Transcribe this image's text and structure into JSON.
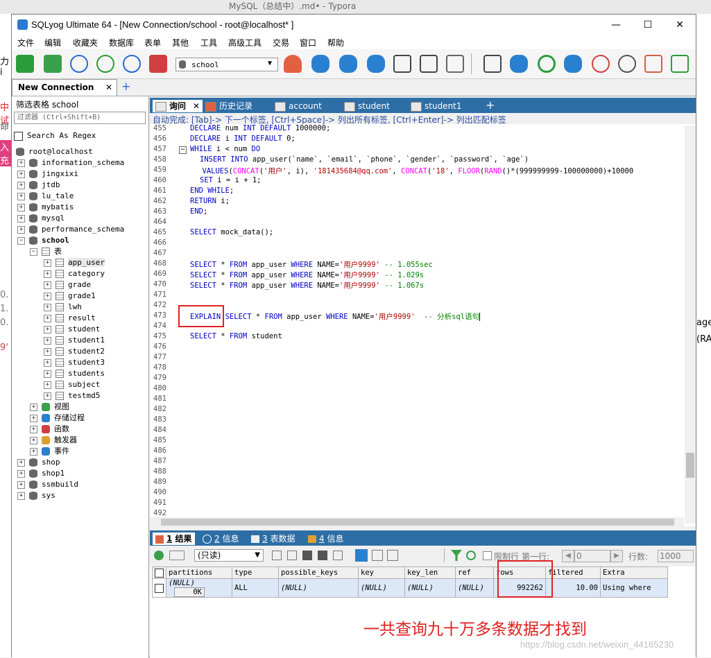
{
  "background": {
    "typora_title": "MySQL（总结中）.md• - Typora",
    "left_chars": [
      "力i",
      "中试",
      "命",
      "入充",
      "0.",
      "1.",
      "0.",
      "9'"
    ],
    "right_chars": [
      "age",
      "(RA"
    ]
  },
  "window": {
    "title": "SQLyog Ultimate 64 - [New Connection/school - root@localhost* ]",
    "minimize": "—",
    "maximize": "☐",
    "close": "✕"
  },
  "menu": [
    "文件",
    "编辑",
    "收藏夹",
    "数据库",
    "表单",
    "其他",
    "工具",
    "高级工具",
    "交易",
    "窗口",
    "帮助"
  ],
  "toolbar": {
    "db_select": "school"
  },
  "connection_tab": {
    "label": "New Connection",
    "close": "✕",
    "add": "+"
  },
  "left_panel": {
    "filter_label": "筛选表格 school",
    "filter_placeholder": "过滤器 (Ctrl+Shift+B)",
    "regex_label": "Search As Regex",
    "root": "root@localhost",
    "databases_before": [
      "information_schema",
      "jingxixi",
      "jtdb",
      "lu_tale",
      "mybatis",
      "mysql",
      "performance_schema"
    ],
    "current_db": "school",
    "tables_folder": "表",
    "tables": [
      "app_user",
      "category",
      "grade",
      "grade1",
      "lwh",
      "result",
      "student",
      "student1",
      "student2",
      "student3",
      "students",
      "subject",
      "testmd5"
    ],
    "folders": [
      "视图",
      "存储过程",
      "函数",
      "触发器",
      "事件"
    ],
    "databases_after": [
      "shop",
      "shop1",
      "ssmbuild",
      "sys"
    ]
  },
  "query_tabs": [
    {
      "label": "询问",
      "close": "✕"
    },
    {
      "label": "历史记录"
    },
    {
      "label": "account"
    },
    {
      "label": "student"
    },
    {
      "label": "student1"
    }
  ],
  "query_tab_add": "+",
  "autocomplete_hint": "自动完成: [Tab]-> 下一个标签, [Ctrl+Space]-> 列出所有标签, [Ctrl+Enter]-> 列出匹配标签",
  "editor": {
    "line_numbers": [
      "455",
      "456",
      "457",
      "458",
      "459",
      "460",
      "461",
      "462",
      "463",
      "464",
      "465",
      "466",
      "467",
      "468",
      "469",
      "470",
      "471",
      "472",
      "473",
      "474",
      "475",
      "476",
      "477",
      "478",
      "479",
      "480",
      "481",
      "482",
      "483",
      "484",
      "485",
      "486",
      "487",
      "488",
      "489",
      "490",
      "491",
      "492"
    ],
    "lines": {
      "455": [
        "DECLARE",
        " num ",
        "INT DEFAULT",
        " 1000000;"
      ],
      "456": [
        "DECLARE",
        " i ",
        "INT DEFAULT",
        " 0;"
      ],
      "457": [
        "WHILE",
        " i < num ",
        "DO"
      ],
      "458": [
        "INSERT INTO",
        " app_user(`name`, `email`, `phone`, `gender`, `password`, `age`)"
      ],
      "459": [
        "VALUES",
        "(",
        "CONCAT",
        "(",
        "'用户'",
        ", i), ",
        "'181435684@qq.com'",
        ", ",
        "CONCAT",
        "(",
        "'18'",
        ", ",
        "FLOOR",
        "(",
        "RAND",
        "()*(999999999-100000000)+10000"
      ],
      "460": [
        "SET",
        " i = i + 1;"
      ],
      "461": [
        "END WHILE",
        ";"
      ],
      "462": [
        "RETURN",
        " i;"
      ],
      "463": [
        "END",
        ";"
      ],
      "465": [
        "SELECT",
        " mock_data();"
      ],
      "468": [
        "SELECT",
        " * ",
        "FROM",
        " app_user ",
        "WHERE",
        " NAME=",
        "'用户9999'",
        " -- 1.055sec"
      ],
      "469": [
        "SELECT",
        " * ",
        "FROM",
        " app_user ",
        "WHERE",
        " NAME=",
        "'用户9999'",
        " -- 1.029s"
      ],
      "470": [
        "SELECT",
        " * ",
        "FROM",
        " app_user ",
        "WHERE",
        " NAME=",
        "'用户9999'",
        " -- 1.067s"
      ],
      "473": [
        "EXPLAIN",
        " ",
        "SELECT",
        " * ",
        "FROM",
        " app_user ",
        "WHERE",
        " NAME=",
        "'用户9999'",
        "  -- 分析sql语句"
      ],
      "475": [
        "SELECT",
        " * ",
        "FROM",
        " student"
      ]
    }
  },
  "result_tabs": [
    {
      "num": "1",
      "label": "结果"
    },
    {
      "num": "2",
      "label": "信息"
    },
    {
      "num": "3",
      "label": "表数据"
    },
    {
      "num": "4",
      "label": "信息"
    }
  ],
  "result_toolbar": {
    "mode": "(只读)",
    "limit_label": "限制行",
    "first_label": "第一行:",
    "first_value": "0",
    "rows_label": "行数:",
    "rows_value": "1000"
  },
  "result_table": {
    "columns": [
      "partitions",
      "type",
      "possible_keys",
      "key",
      "key_len",
      "ref",
      "rows",
      "filtered",
      "Extra"
    ],
    "row": {
      "partitions": "(NULL)",
      "partitions_btn": "0K",
      "type": "ALL",
      "possible_keys": "(NULL)",
      "key": "(NULL)",
      "key_len": "(NULL)",
      "ref": "(NULL)",
      "rows": "992262",
      "filtered": "10.00",
      "Extra": "Using where"
    }
  },
  "annotation": "一共查询九十万多条数据才找到",
  "watermark": "https://blog.csdn.net/weixin_44165230",
  "colors": {
    "tab_blue": "#2e6ea6",
    "keyword": "#0000c0",
    "string": "#b00000",
    "function": "#ff00ff",
    "comment": "#008000",
    "annotation_red": "#e02020"
  }
}
